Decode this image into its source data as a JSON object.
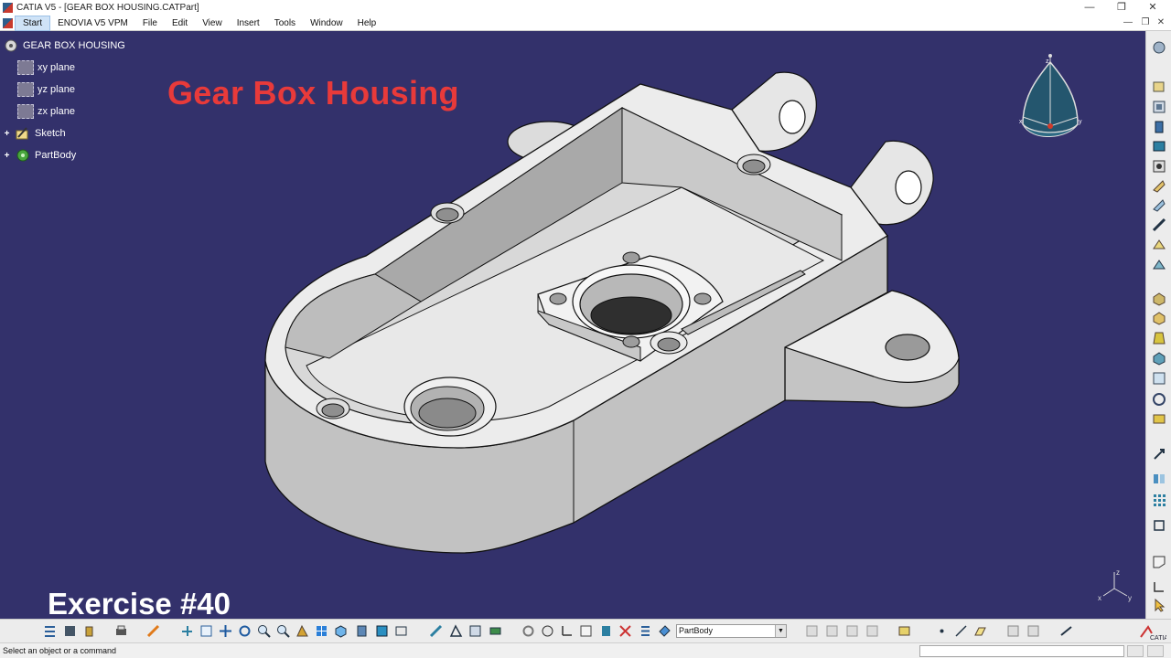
{
  "window": {
    "title": "CATIA V5 - [GEAR BOX HOUSING.CATPart]",
    "minimize_icon": "minimize-icon",
    "maximize_icon": "restore-icon",
    "close_icon": "close-icon"
  },
  "menu": {
    "items": [
      "Start",
      "ENOVIA V5 VPM",
      "File",
      "Edit",
      "View",
      "Insert",
      "Tools",
      "Window",
      "Help"
    ]
  },
  "tree": {
    "root": "GEAR BOX HOUSING",
    "items": [
      {
        "label": "xy plane",
        "icon": "plane-icon"
      },
      {
        "label": "yz plane",
        "icon": "plane-icon"
      },
      {
        "label": "zx plane",
        "icon": "plane-icon"
      },
      {
        "label": "Sketch",
        "icon": "sketch-icon"
      },
      {
        "label": "PartBody",
        "icon": "partbody-icon"
      }
    ]
  },
  "overlay": {
    "headline": "Gear Box Housing",
    "exercise": "Exercise #40"
  },
  "compass": {
    "label_z": "z",
    "label_x": "x",
    "label_y": "y"
  },
  "toolbar": {
    "current_body": "PartBody"
  },
  "status": {
    "message": "Select an object or a command"
  },
  "colors": {
    "viewport_bg": "#33316b",
    "headline": "#e83a3a",
    "part_fill": "#e9e9e9",
    "part_shade": "#b9b9b9"
  }
}
